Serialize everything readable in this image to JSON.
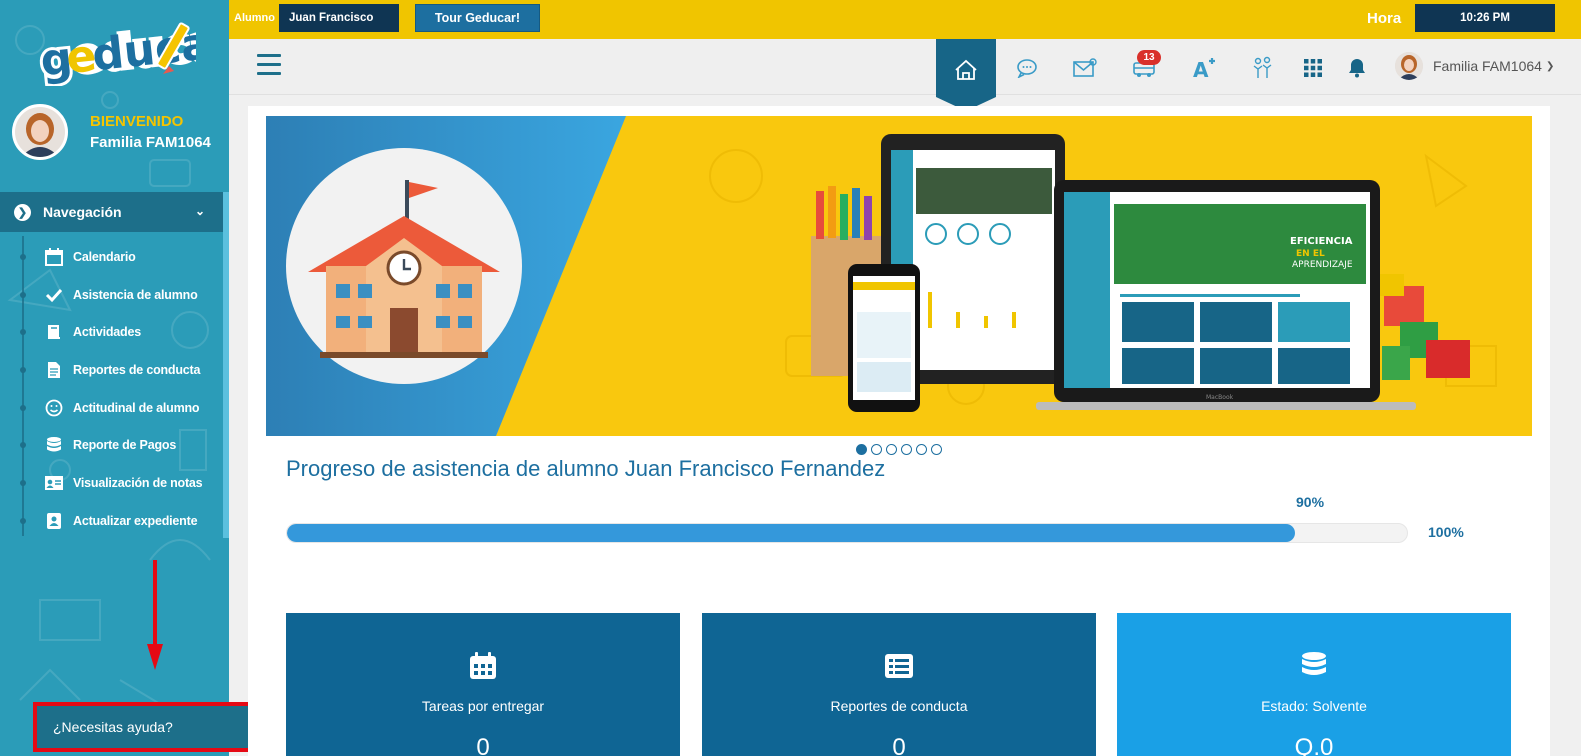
{
  "topbar": {
    "alumno_label": "Alumno",
    "alumno_value": "Juan Francisco",
    "tour_button": "Tour Geducar!",
    "hora_label": "Hora",
    "hora_value": "10:26 PM"
  },
  "sidebar": {
    "logo_text": "geducar",
    "welcome": "BIENVENIDO",
    "family_name": "Familia FAM1064",
    "nav_header": "Navegación",
    "items": [
      {
        "label": "Calendario",
        "icon": "calendar-icon"
      },
      {
        "label": "Asistencia de alumno",
        "icon": "check-icon"
      },
      {
        "label": "Actividades",
        "icon": "book-icon"
      },
      {
        "label": "Reportes de conducta",
        "icon": "document-icon"
      },
      {
        "label": "Actitudinal de alumno",
        "icon": "smile-icon"
      },
      {
        "label": "Reporte de Pagos",
        "icon": "database-icon"
      },
      {
        "label": "Visualización de notas",
        "icon": "id-card-icon"
      },
      {
        "label": "Actualizar expediente",
        "icon": "user-file-icon"
      }
    ],
    "help_text": "¿Necesitas ayuda?"
  },
  "navbar": {
    "notification_count": "13",
    "user_name": "Familia FAM1064",
    "icons": [
      "home-icon",
      "chat-icon",
      "mail-icon",
      "bus-icon",
      "grade-icon",
      "people-icon",
      "apps-grid-icon",
      "bell-icon"
    ]
  },
  "banner": {
    "slides": 6,
    "active_slide": 1,
    "headline_1": "EFICIENCIA",
    "headline_2": "EN EL",
    "headline_3": "APRENDIZAJE",
    "laptop_brand": "MacBook"
  },
  "progress": {
    "title": "Progreso de asistencia de alumno Juan Francisco Fernandez",
    "current_label": "90%",
    "current_value": 0.9,
    "max_label": "100%"
  },
  "cards": [
    {
      "title": "Tareas por entregar",
      "value": "0",
      "color": "#0f6594",
      "icon": "calendar-icon"
    },
    {
      "title": "Reportes de conducta",
      "value": "0",
      "color": "#0f6594",
      "icon": "list-icon"
    },
    {
      "title": "Estado: Solvente",
      "value": "Q.0",
      "color": "#1aa0e6",
      "icon": "database-icon"
    }
  ],
  "colors": {
    "sidebar": "#2b9cb8",
    "topbar": "#f0c500",
    "dark_navy": "#0f3553",
    "accent_blue": "#1d6fa0",
    "progress_fill": "#3498db",
    "highlight_red": "#e50914"
  }
}
